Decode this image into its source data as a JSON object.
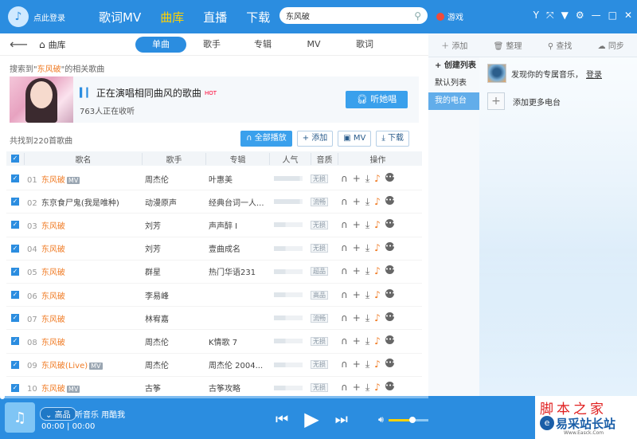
{
  "header": {
    "login_label": "点此登录",
    "nav": [
      {
        "label": "歌词MV"
      },
      {
        "label": "曲库"
      },
      {
        "label": "直播"
      },
      {
        "label": "下载"
      }
    ],
    "active_nav": "曲库",
    "search_value": "东风破",
    "game_label": "游戏"
  },
  "subnav": {
    "crumb": "曲库",
    "tabs": [
      {
        "label": "单曲"
      },
      {
        "label": "歌手"
      },
      {
        "label": "专辑"
      },
      {
        "label": "MV"
      },
      {
        "label": "歌词"
      }
    ]
  },
  "result": {
    "prefix": "搜索到\"",
    "keyword": "东风破",
    "suffix": "\"的相关歌曲"
  },
  "banner": {
    "title": "正在演唱相同曲风的歌曲",
    "hot": "HOT",
    "listeners": "763人正在收听",
    "button": "听她唱"
  },
  "toolbar": {
    "total": "共找到220首歌曲",
    "play_all": "全部播放",
    "add": "添加",
    "mv": "MV",
    "download": "下载"
  },
  "columns": {
    "name": "歌名",
    "singer": "歌手",
    "album": "专辑",
    "popularity": "人气",
    "quality": "音质",
    "ops": "操作"
  },
  "songs": [
    {
      "num": "01",
      "name": "东风破",
      "mv": "MV",
      "singer": "周杰伦",
      "album": "叶惠美",
      "quality": "无损",
      "highlight": true,
      "popularity": 0.9
    },
    {
      "num": "02",
      "name": "东京食尸鬼(我是唯种)",
      "mv": "",
      "singer": "动漫原声",
      "album": "经典台词一人...",
      "quality": "流畅",
      "highlight": false,
      "popularity": 0.9
    },
    {
      "num": "03",
      "name": "东风破",
      "mv": "",
      "singer": "刘芳",
      "album": "声声醉 I",
      "quality": "无损",
      "highlight": true,
      "popularity": 0.4
    },
    {
      "num": "04",
      "name": "东风破",
      "mv": "",
      "singer": "刘芳",
      "album": "壹曲成名",
      "quality": "无损",
      "highlight": true,
      "popularity": 0.4
    },
    {
      "num": "05",
      "name": "东风破",
      "mv": "",
      "singer": "群星",
      "album": "热门华语231",
      "quality": "超品",
      "highlight": true,
      "popularity": 0.4
    },
    {
      "num": "06",
      "name": "东风破",
      "mv": "",
      "singer": "李易峰",
      "album": "",
      "quality": "高品",
      "highlight": true,
      "popularity": 0.4
    },
    {
      "num": "07",
      "name": "东风破",
      "mv": "",
      "singer": "林宥嘉",
      "album": "",
      "quality": "流畅",
      "highlight": true,
      "popularity": 0.4
    },
    {
      "num": "08",
      "name": "东风破",
      "mv": "",
      "singer": "周杰伦",
      "album": "K情歌 7",
      "quality": "无损",
      "highlight": true,
      "popularity": 0.4
    },
    {
      "num": "09",
      "name": "东风破(Live)",
      "mv": "MV",
      "singer": "周杰伦",
      "album": "周杰伦 2004...",
      "quality": "无损",
      "highlight": true,
      "popularity": 0.4
    },
    {
      "num": "10",
      "name": "东风破",
      "mv": "MV",
      "singer": "古筝",
      "album": "古筝攻略",
      "quality": "无损",
      "highlight": true,
      "popularity": 0.4
    }
  ],
  "right": {
    "tools": [
      {
        "icon": "plus-icon",
        "label": "添加"
      },
      {
        "icon": "trash-icon",
        "label": "整理"
      },
      {
        "icon": "search-icon",
        "label": "查找"
      },
      {
        "icon": "cloud-icon",
        "label": "同步"
      }
    ],
    "create_list": "创建列表",
    "default_list": "默认列表",
    "my_radio": "我的电台",
    "recommend": "发现你的专属音乐，",
    "login_link": "登录",
    "add_station": "添加更多电台"
  },
  "player": {
    "quality": "高品",
    "title": "听音乐 用酷我",
    "time_current": "00:00",
    "time_total": "00:00",
    "volume": 0.6,
    "progress": 0.0
  },
  "watermark": {
    "line1": "脚本之家",
    "line2": "易采站长站",
    "small": "Www.Easck.Com"
  },
  "colors": {
    "accent": "#2b8de0",
    "highlight": "#f07b24",
    "nav_active": "#ffd200"
  }
}
